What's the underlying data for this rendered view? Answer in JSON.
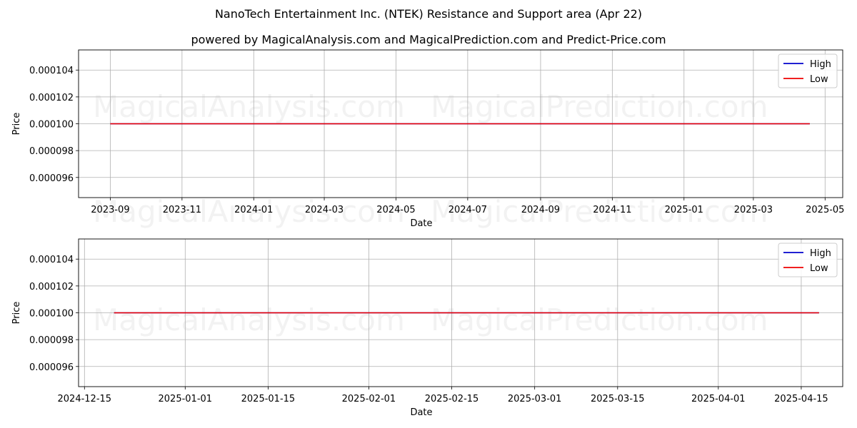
{
  "title": "NanoTech Entertainment Inc. (NTEK) Resistance and Support area (Apr 22)",
  "subtitle": "powered by MagicalAnalysis.com and MagicalPrediction.com and Predict-Price.com",
  "watermarks": [
    "MagicalAnalysis.com",
    "MagicalPrediction.com"
  ],
  "colors": {
    "high": "#0000cc",
    "low": "#ee0000",
    "grid": "#b0b0b0"
  },
  "chart_data": [
    {
      "type": "line",
      "xlabel": "Date",
      "ylabel": "Price",
      "x_ticks": [
        "2023-09",
        "2023-11",
        "2024-01",
        "2024-03",
        "2024-05",
        "2024-07",
        "2024-09",
        "2024-11",
        "2025-01",
        "2025-03",
        "2025-05"
      ],
      "y_ticks": [
        "0.000096",
        "0.000098",
        "0.000100",
        "0.000102",
        "0.000104"
      ],
      "ylim": [
        9.45e-05,
        0.0001055
      ],
      "xlim": [
        "2023-08-05",
        "2025-05-16"
      ],
      "grid": true,
      "legend": "top-right",
      "series": [
        {
          "name": "High",
          "color": "#0000cc",
          "x": [
            "2023-09-01",
            "2025-04-18"
          ],
          "values": [
            0.0001,
            0.0001
          ]
        },
        {
          "name": "Low",
          "color": "#ee0000",
          "x": [
            "2023-09-01",
            "2025-04-18"
          ],
          "values": [
            0.0001,
            0.0001
          ]
        }
      ]
    },
    {
      "type": "line",
      "xlabel": "Date",
      "ylabel": "Price",
      "x_ticks": [
        "2024-12-15",
        "2025-01-01",
        "2025-01-15",
        "2025-02-01",
        "2025-02-15",
        "2025-03-01",
        "2025-03-15",
        "2025-04-01",
        "2025-04-15"
      ],
      "y_ticks": [
        "0.000096",
        "0.000098",
        "0.000100",
        "0.000102",
        "0.000104"
      ],
      "ylim": [
        9.45e-05,
        0.0001055
      ],
      "xlim": [
        "2024-12-14",
        "2025-04-22"
      ],
      "grid": true,
      "legend": "top-right",
      "series": [
        {
          "name": "High",
          "color": "#0000cc",
          "x": [
            "2024-12-20",
            "2025-04-18"
          ],
          "values": [
            0.0001,
            0.0001
          ]
        },
        {
          "name": "Low",
          "color": "#ee0000",
          "x": [
            "2024-12-20",
            "2025-04-18"
          ],
          "values": [
            0.0001,
            0.0001
          ]
        }
      ]
    }
  ]
}
